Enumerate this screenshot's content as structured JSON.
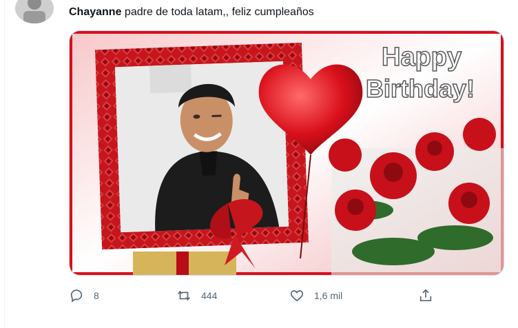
{
  "tweet": {
    "author": "Chayanne",
    "text": " padre de toda latam,, feliz cumpleaños"
  },
  "media": {
    "headline_line1": "Happy",
    "headline_line2": "Birthday!"
  },
  "actions": {
    "reply_count": "8",
    "retweet_count": "444",
    "like_count": "1,6 mil"
  },
  "colors": {
    "frame_red": "#c4161c",
    "accent_red": "#d90f1a",
    "icon_gray": "#536471"
  }
}
